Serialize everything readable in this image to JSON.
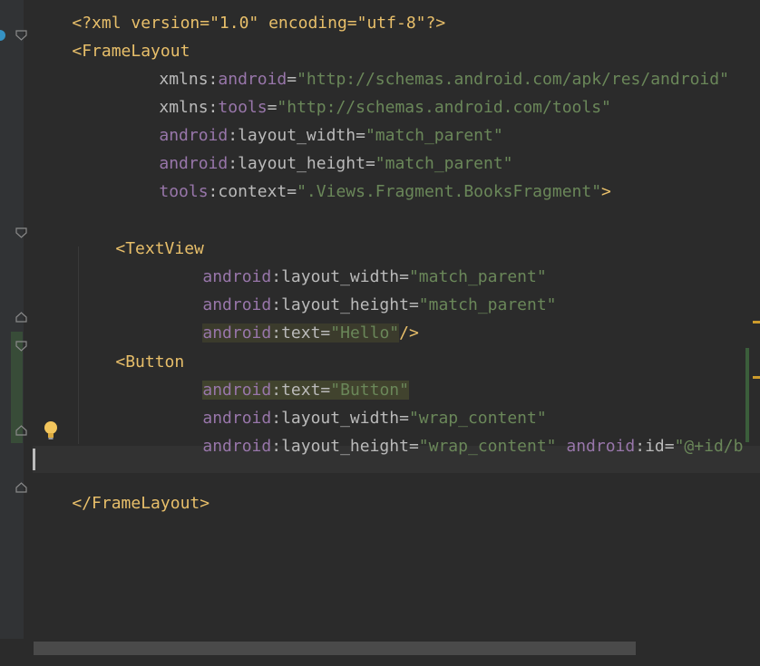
{
  "editor": {
    "lines": {
      "xml_decl": "<?xml version=\"1.0\" encoding=\"utf-8\"?>",
      "framelayout_open": "<FrameLayout",
      "xmlns_android_ns": "xmlns",
      "xmlns_android_prefix": "android",
      "xmlns_android_value": "\"http://schemas.android.com/apk/res/android\"",
      "xmlns_tools_ns": "xmlns",
      "xmlns_tools_prefix": "tools",
      "xmlns_tools_value": "\"http://schemas.android.com/tools\"",
      "fl_width_ns": "android",
      "fl_width_attr": "layout_width",
      "fl_width_value": "\"match_parent\"",
      "fl_height_ns": "android",
      "fl_height_attr": "layout_height",
      "fl_height_value": "\"match_parent\"",
      "fl_context_ns": "tools",
      "fl_context_attr": "context",
      "fl_context_value": "\".Views.Fragment.BooksFragment\"",
      "fl_close_bracket": ">",
      "textview_open": "<TextView",
      "tv_width_ns": "android",
      "tv_width_attr": "layout_width",
      "tv_width_value": "\"match_parent\"",
      "tv_height_ns": "android",
      "tv_height_attr": "layout_height",
      "tv_height_value": "\"match_parent\"",
      "tv_text_ns": "android",
      "tv_text_attr": "text",
      "tv_text_value": "\"Hello\"",
      "tv_self_close": "/>",
      "button_open": "<Button",
      "btn_text_ns": "android",
      "btn_text_attr": "text",
      "btn_text_value": "\"Button\"",
      "btn_width_ns": "android",
      "btn_width_attr": "layout_width",
      "btn_width_value": "\"wrap_content\"",
      "btn_height_ns": "android",
      "btn_height_attr": "layout_height",
      "btn_height_value": "\"wrap_content\"",
      "btn_id_ns": "android",
      "btn_id_attr": "id",
      "btn_id_value": "\"@+id/b",
      "framelayout_close": "</FrameLayout>"
    },
    "sep_colon": ":",
    "sep_eq": "=",
    "colors": {
      "background": "#2b2b2b",
      "tag": "#e8bf6a",
      "namespace": "#9876aa",
      "attribute": "#bababa",
      "string": "#6a8759"
    },
    "icons": {
      "fold": "fold-marker-icon",
      "bulb": "lightbulb-icon"
    }
  }
}
